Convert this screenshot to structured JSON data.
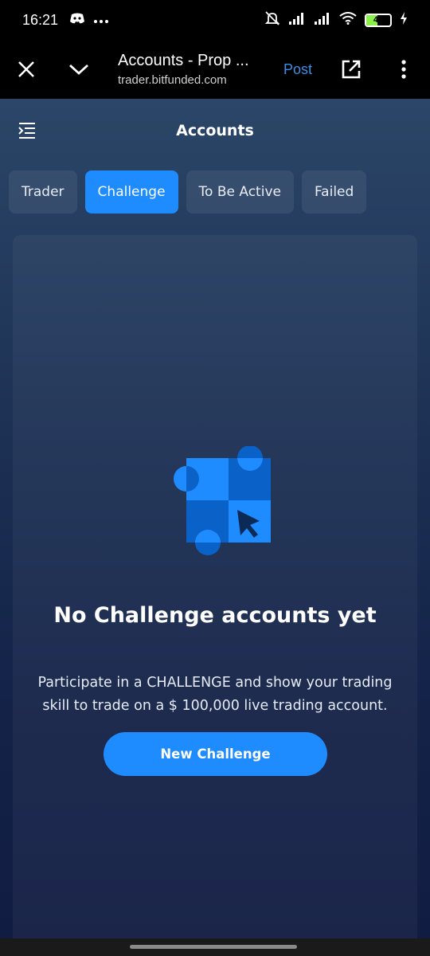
{
  "status_bar": {
    "time": "16:21",
    "battery_level": "48",
    "icons": [
      "discord-icon",
      "more-dots-icon",
      "mute-icon",
      "signal-icon",
      "signal-icon",
      "wifi-icon",
      "battery-icon",
      "charging-icon"
    ]
  },
  "browser": {
    "title": "Accounts - Prop ...",
    "url": "trader.bitfunded.com",
    "post_label": "Post",
    "accent": "#3c8fe8"
  },
  "app": {
    "title": "Accounts",
    "tabs": [
      {
        "label": "Trader",
        "active": false
      },
      {
        "label": "Challenge",
        "active": true
      },
      {
        "label": "To Be Active",
        "active": false
      },
      {
        "label": "Failed",
        "active": false
      }
    ],
    "empty_state": {
      "title": "No Challenge accounts yet",
      "description_line1": "Participate in a CHALLENGE and show your trading",
      "description_line2": "skill to trade on a $ 100,000 live trading account.",
      "button_label": "New Challenge"
    },
    "colors": {
      "primary": "#1e8cff",
      "dark_blue": "#0a62c8"
    }
  }
}
